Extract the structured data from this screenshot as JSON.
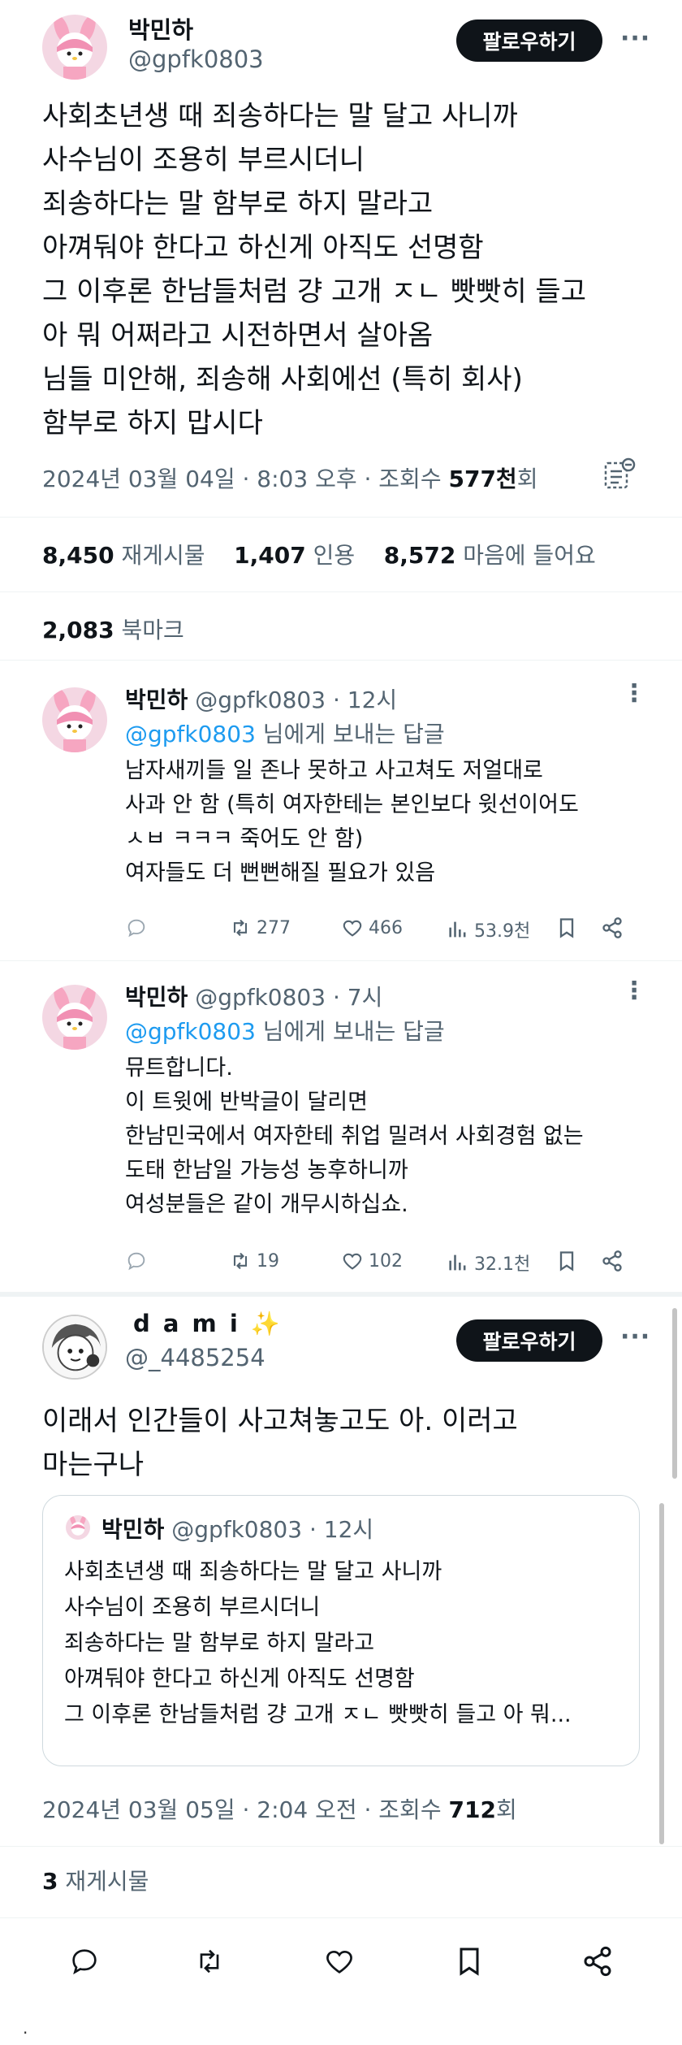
{
  "main_tweet": {
    "display_name": "박민하",
    "handle": "@gpfk0803",
    "follow_label": "팔로우하기",
    "more_label": "···",
    "lines": [
      "사회초년생 때 죄송하다는 말 달고 사니까",
      "사수님이 조용히 부르시더니",
      "죄송하다는 말 함부로 하지 말라고",
      "아껴둬야 한다고 하신게 아직도 선명함",
      "그 이후론 한남들처럼 걍 고개 ㅈㄴ 빳빳히 들고",
      "아 뭐 어쩌라고 시전하면서 살아옴",
      "님들 미안해, 죄송해 사회에선 (특히 회사)",
      "함부로 하지 맙시다"
    ],
    "timestamp": "2024년 03월 04일 · 8:03 오후 · 조회수 ",
    "views": "577천",
    "views_suffix": "회",
    "retweets_count": "8,450",
    "retweets_label": "재게시물",
    "quotes_count": "1,407",
    "quotes_label": "인용",
    "likes_count": "8,572",
    "likes_label": "마음에 들어요",
    "bookmarks_count": "2,083",
    "bookmarks_label": "북마크"
  },
  "replies": [
    {
      "display_name": "박민하",
      "handle_time": "@gpfk0803 · 12시",
      "reply_to_handle": "@gpfk0803",
      "reply_to_suffix": " 님에게 보내는 답글",
      "lines": [
        "남자새끼들 일 존나 못하고 사고쳐도 저얼대로",
        "사과 안 함 (특히 여자한테는 본인보다 윗선이어도",
        "ㅅㅂ ㅋㅋㅋ 죽어도 안 함)",
        "여자들도 더 뻔뻔해질 필요가 있음"
      ],
      "retweets": "277",
      "likes": "466",
      "views": "53.9천"
    },
    {
      "display_name": "박민하",
      "handle_time": "@gpfk0803 · 7시",
      "reply_to_handle": "@gpfk0803",
      "reply_to_suffix": " 님에게 보내는 답글",
      "lines": [
        "뮤트합니다.",
        "이 트윗에 반박글이 달리면",
        "한남민국에서 여자한테 취업 밀려서 사회경험 없는",
        "도태 한남일 가능성 농후하니까",
        "여성분들은 같이 개무시하십쇼."
      ],
      "retweets": "19",
      "likes": "102",
      "views": "32.1천"
    }
  ],
  "quote_tweet": {
    "display_name": "d a m i",
    "sparkle": "✨",
    "handle": "@_4485254",
    "follow_label": "팔로우하기",
    "more_label": "···",
    "lines": [
      "이래서 인간들이 사고쳐놓고도 아. 이러고",
      "마는구나"
    ],
    "quoted": {
      "display_name": "박민하",
      "handle_time": "@gpfk0803 · 12시",
      "lines": [
        "사회초년생 때 죄송하다는 말 달고 사니까",
        "사수님이 조용히 부르시더니",
        "죄송하다는 말 함부로 하지 말라고",
        "아껴둬야 한다고 하신게 아직도 선명함",
        "그 이후론 한남들처럼 걍 고개 ㅈㄴ 빳빳히 들고 아 뭐..."
      ]
    },
    "timestamp": "2024년 03월 05일 · 2:04 오전 · 조회수 ",
    "views": "712",
    "views_suffix": "회",
    "retweets_count": "3",
    "retweets_label": "재게시물"
  },
  "footer_dot": "."
}
